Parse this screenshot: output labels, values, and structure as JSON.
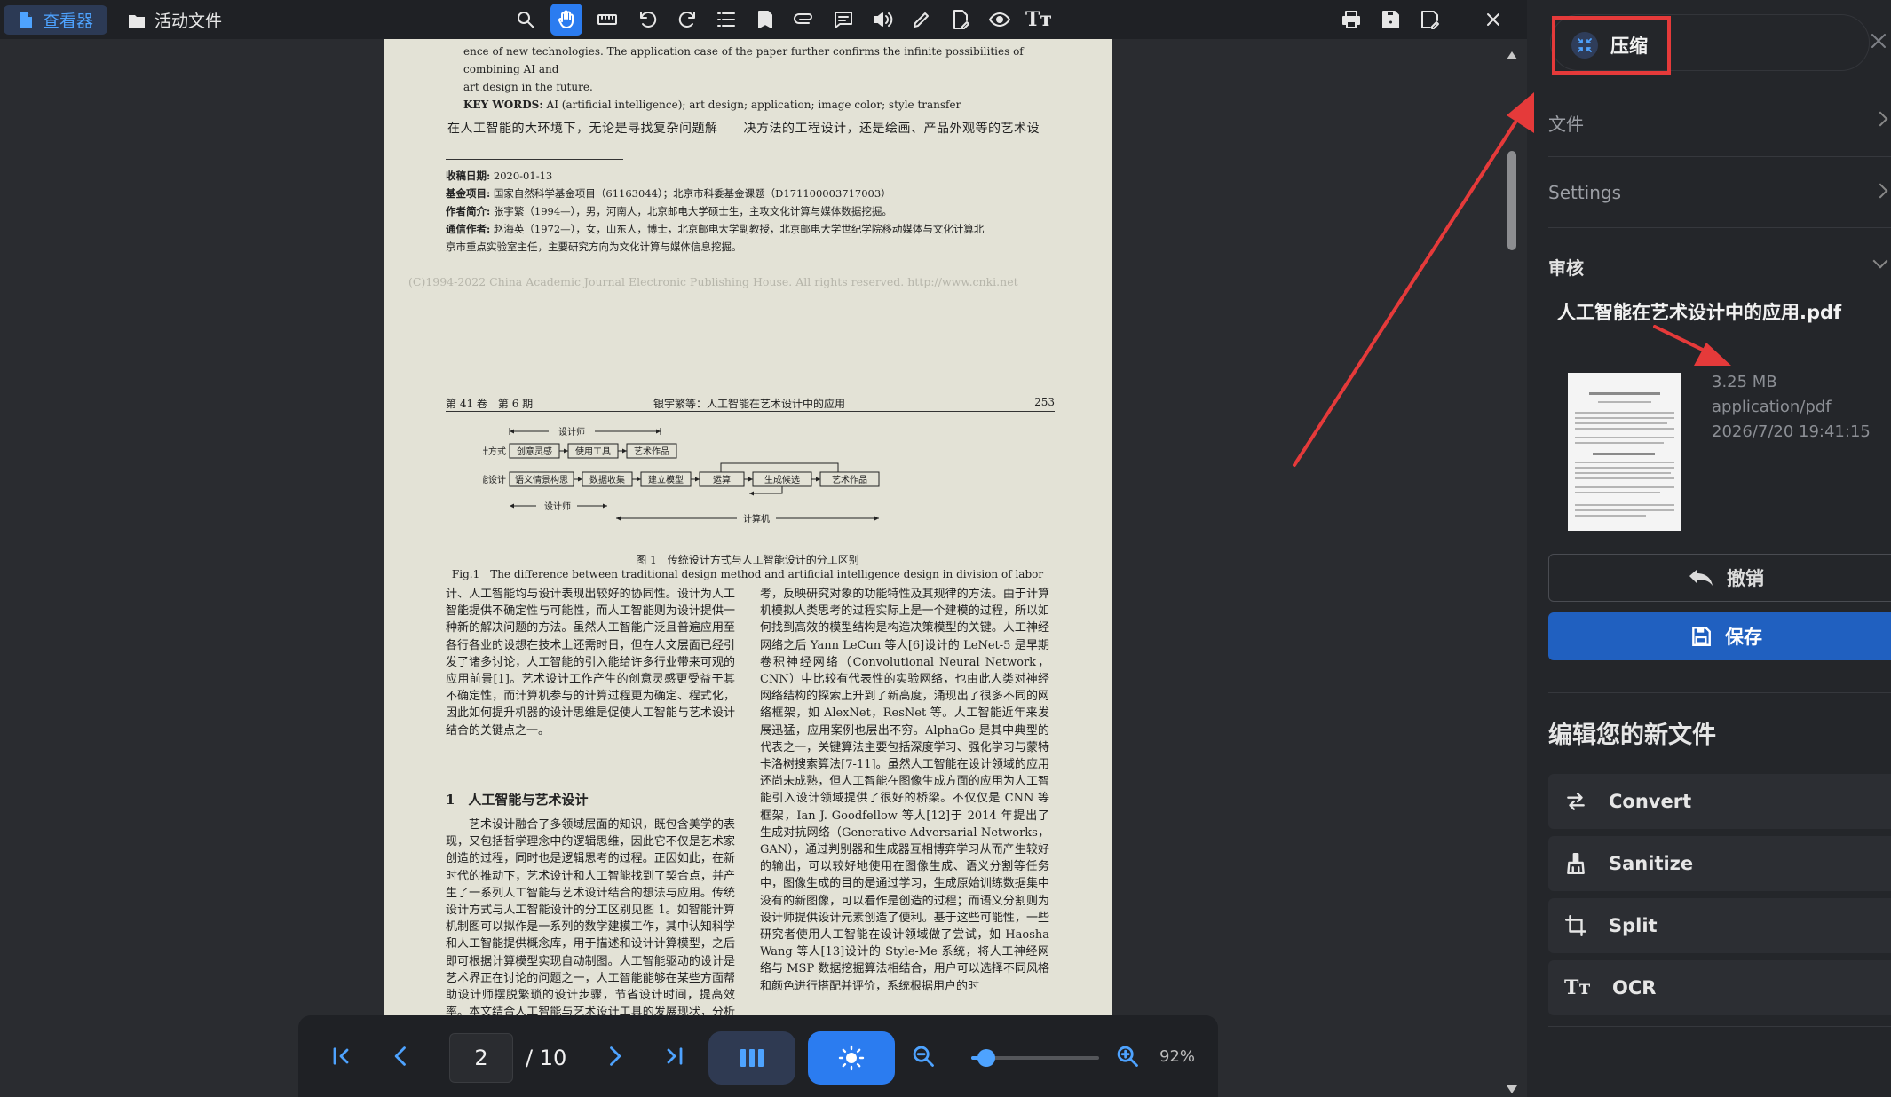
{
  "topbar": {
    "tab_viewer": "查看器",
    "tab_files": "活动文件"
  },
  "page1": {
    "abstract_line1": "ence of new technologies. The application case of the paper further confirms the infinite possibilities of combining AI and",
    "abstract_line2": "art design in the future.",
    "keywords_label": "KEY WORDS:",
    "keywords_text": " AI (artificial intelligence); art design; application; image color; style transfer",
    "cn_line": "在人工智能的大环境下，无论是寻找复杂问题解　　决方法的工程设计，还是绘画、产品外观等的艺术设",
    "meta": [
      {
        "k": "收稿日期:",
        "v": " 2020-01-13"
      },
      {
        "k": "基金项目:",
        "v": " 国家自然科学基金项目（61163044）；北京市科委基金课题（D171100003717003）"
      },
      {
        "k": "作者简介:",
        "v": " 张宇繁（1994—），男，河南人，北京邮电大学硕士生，主攻文化计算与媒体数据挖掘。"
      },
      {
        "k": "通信作者:",
        "v": " 赵海英（1972—），女，山东人，博士，北京邮电大学副教授，北京邮电大学世纪学院移动媒体与文化计算北"
      },
      {
        "k": "",
        "v": "京市重点实验室主任，主要研究方向为文化计算与媒体信息挖掘。"
      }
    ],
    "copyright": "(C)1994-2022 China Academic Journal Electronic Publishing House. All rights reserved.    http://www.cnki.net"
  },
  "page2": {
    "header_left": "第 41 卷　第 6 期",
    "header_center": "银宇繁等：人工智能在艺术设计中的应用",
    "header_right": "253",
    "fig": {
      "designer_top": "设计师",
      "row1_label": "传统设计方式",
      "row1_boxes": [
        "创意灵感",
        "使用工具",
        "艺术作品"
      ],
      "row2_label": "人工智能设计",
      "row2_boxes": [
        "语义情景构思",
        "数据收集",
        "建立模型",
        "运算",
        "生成候选",
        "艺术作品"
      ],
      "designer_bottom": "设计师",
      "computer": "计算机"
    },
    "fig_caption_cn": "图 1　传统设计方式与人工智能设计的分工区别",
    "fig_caption_en": "Fig.1　The difference between traditional design method and artificial intelligence design in division of labor",
    "left_col_top": "计、人工智能均与设计表现出较好的协同性。设计为人工智能提供不确定性与可能性，而人工智能则为设计提供一种新的解决问题的方法。虽然人工智能广泛且普遍应用至各行各业的设想在技术上还需时日，但在人文层面已经引发了诸多讨论，人工智能的引入能给许多行业带来可观的应用前景[1]。艺术设计工作产生的创意灵感更受益于其不确定性，而计算机参与的计算过程更为确定、程式化，因此如何提升机器的设计思维是促使人工智能与艺术设计结合的关键点之一。",
    "section_title": "1　人工智能与艺术设计",
    "left_col_bottom": "艺术设计融合了多领域层面的知识，既包含美学的表现，又包括哲学理念中的逻辑思维，因此它不仅是艺术家创造的过程，同时也是逻辑思考的过程。正因如此，在新时代的推动下，艺术设计和人工智能找到了契合点，并产生了一系列人工智能与艺术设计结合的想法与应用。传统设计方式与人工智能设计的分工区别见图 1。如智能计算机制图可以拟作是一系列的数学建模工作，其中认知科学和人工智能提供概念库，用于描述和设计计算模型，之后即可根据计算模型实现自动制图。人工智能驱动的设计是艺术界正在讨论的问题之一，人工智能能够在某些方面帮助设计师摆脱繁琐的设计步骤，节省设计时间，提高效率。本文结合人工智能与艺术设计工具的发展现状，分析了人工智能与艺术设计的结合点以及未来发展趋势，并",
    "right_col": "考，反映研究对象的功能特性及其规律的方法。由于计算机模拟人类思考的过程实际上是一个建模的过程，所以如何找到高效的模型结构是构造决策模型的关键。人工神经网络之后 Yann LeCun 等人[6]设计的 LeNet-5 是早期卷积神经网络（Convolutional Neural Network，CNN）中比较有代表性的实验网络，也由此人类对神经网络结构的探索上升到了新高度，涌现出了很多不同的网络框架，如 AlexNet，ResNet 等。人工智能近年来发展迅猛，应用案例也层出不穷。AlphaGo 是其中典型的代表之一，关键算法主要包括深度学习、强化学习与蒙特卡洛树搜索算法[7-11]。虽然人工智能在设计领域的应用还尚未成熟，但人工智能在图像生成方面的应用为人工智能引入设计领域提供了很好的桥梁。不仅仅是 CNN 等框架，Ian J. Goodfellow 等人[12]于 2014 年提出了生成对抗网络（Generative Adversarial Networks，GAN），通过判别器和生成器互相博弈学习从而产生较好的输出，可以较好地使用在图像生成、语义分割等任务中，图像生成的目的是通过学习，生成原始训练数据集中没有的新图像，可以看作是创造的过程；而语义分割则为设计师提供设计元素创造了便利。基于这些可能性，一些研究者使用人工智能在设计领域做了尝试，如 Haosha Wang 等人[13]设计的 Style-Me 系统，将人工神经网络与 MSP 数据挖掘算法相结合，用户可以选择不同风格和颜色进行搭配并评价，系统根据用户的时"
  },
  "bottomnav": {
    "page_current": "2",
    "page_total": "/ 10",
    "zoom": 0.12,
    "zoom_label": "92%"
  },
  "sidebar": {
    "compress_label": "压缩",
    "section_file": "文件",
    "section_settings": "Settings",
    "section_review": "审核",
    "file_name": "人工智能在艺术设计中的应用.pdf",
    "file_size": "3.25 MB",
    "file_type": "application/pdf",
    "file_date": "2026/7/20 19:41:15",
    "undo_label": "撤销",
    "save_label": "保存",
    "edit_title": "编辑您的新文件",
    "tools": [
      {
        "label": "Convert",
        "icon": "convert-icon"
      },
      {
        "label": "Sanitize",
        "icon": "sanitize-icon"
      },
      {
        "label": "Split",
        "icon": "split-icon"
      },
      {
        "label": "OCR",
        "icon": "ocr-icon"
      }
    ]
  },
  "colors": {
    "accent": "#2b7cf0",
    "annotation_red": "#e53a3a",
    "page_paper": "#e3e2d6"
  }
}
